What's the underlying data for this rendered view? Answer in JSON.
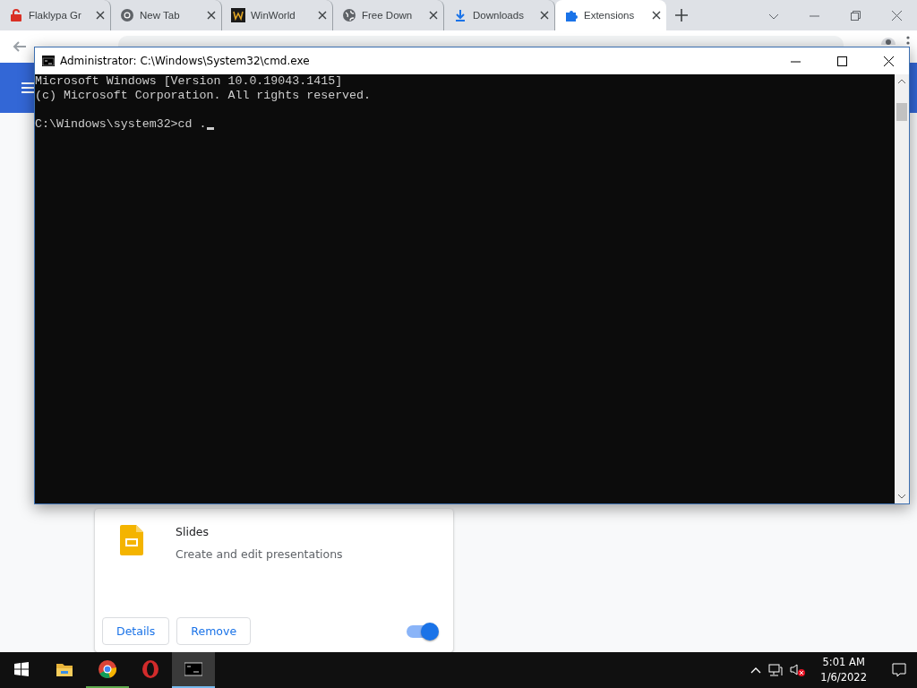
{
  "browser": {
    "tabs": [
      {
        "label": "Flaklypa Gr",
        "kind": "lock",
        "selected": false
      },
      {
        "label": "New Tab",
        "kind": "chrome",
        "selected": false
      },
      {
        "label": "WinWorld",
        "kind": "winworld",
        "selected": false
      },
      {
        "label": "Free Down",
        "kind": "globe",
        "selected": false
      },
      {
        "label": "Downloads",
        "kind": "download",
        "selected": false
      },
      {
        "label": "Extensions",
        "kind": "puzzle",
        "selected": true
      }
    ],
    "extension_card": {
      "name": "Slides",
      "description": "Create and edit presentations",
      "buttons": [
        "Details",
        "Remove"
      ],
      "enabled": true
    }
  },
  "console_window": {
    "title": "Administrator: C:\\Windows\\System32\\cmd.exe",
    "output": [
      "Microsoft Windows [Version 10.0.19043.1415]",
      "(c) Microsoft Corporation. All rights reserved."
    ],
    "prompt": "C:\\Windows\\system32>cd ."
  },
  "taskbar": {
    "apps": [
      {
        "kind": "explorer",
        "running": false,
        "selected": false
      },
      {
        "kind": "chrome",
        "running": true,
        "selected": false
      },
      {
        "kind": "opera",
        "running": false,
        "selected": false
      },
      {
        "kind": "console",
        "running": true,
        "selected": true
      }
    ],
    "clock": {
      "time": "5:01 AM",
      "date": "1/6/2022"
    }
  }
}
